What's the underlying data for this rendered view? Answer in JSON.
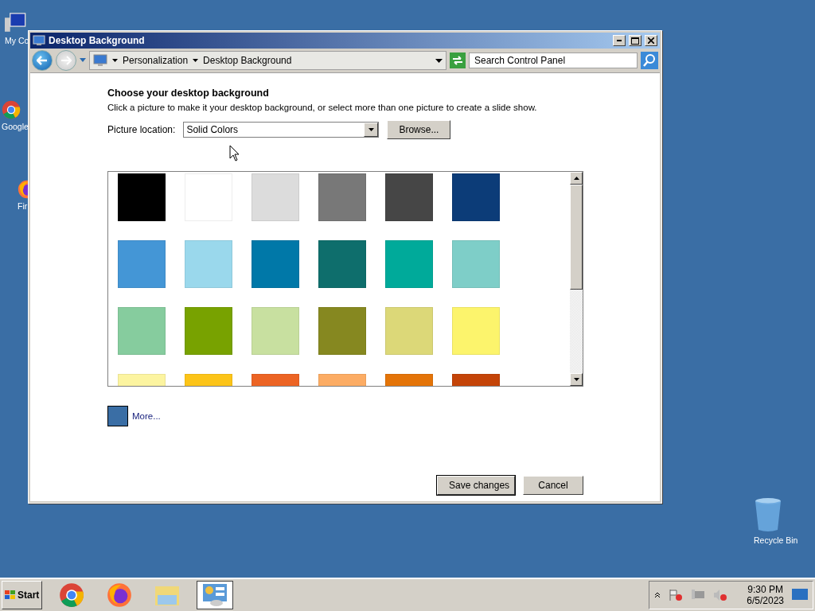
{
  "desktop_icons": [
    {
      "label": "My Co",
      "kind": "computer"
    },
    {
      "label": "Google",
      "kind": "chrome"
    },
    {
      "label": "Fir",
      "kind": "firefox"
    },
    {
      "label": "Recycle Bin",
      "kind": "bin"
    }
  ],
  "window": {
    "title": "Desktop Background",
    "breadcrumb": [
      "Personalization",
      "Desktop Background"
    ],
    "search": {
      "placeholder": "Search Control Panel"
    },
    "heading": "Choose your desktop background",
    "description": "Click a picture to make it your desktop background, or select more than one picture to create a slide show.",
    "location_label": "Picture location:",
    "location_value": "Solid Colors",
    "browse": "Browse...",
    "swatches": [
      {
        "color": "#000000"
      },
      {
        "color": "#ffffff"
      },
      {
        "color": "#dcdcdc"
      },
      {
        "color": "#787878"
      },
      {
        "color": "#464646"
      },
      {
        "color": "#0c3c78"
      },
      {
        "color": "#4496d6"
      },
      {
        "color": "#9ad8ec"
      },
      {
        "color": "#0078a8"
      },
      {
        "color": "#0e6e6c"
      },
      {
        "color": "#00aa9a"
      },
      {
        "color": "#7ecec8"
      },
      {
        "color": "#86cc9e"
      },
      {
        "color": "#78a200"
      },
      {
        "color": "#c8e0a0"
      },
      {
        "color": "#868820"
      },
      {
        "color": "#dcd878"
      },
      {
        "color": "#fcf46c"
      },
      {
        "color": "#fcf4a0"
      },
      {
        "color": "#fcc418"
      },
      {
        "color": "#ec6424"
      },
      {
        "color": "#fcac64"
      },
      {
        "color": "#e47408"
      },
      {
        "color": "#c44408"
      }
    ],
    "more": {
      "label": "More...",
      "color": "#3a6ea5"
    },
    "buttons": [
      "Save changes",
      "Cancel"
    ]
  },
  "taskbar": {
    "start": "Start",
    "apps": [
      {
        "kind": "chrome",
        "selected": false
      },
      {
        "kind": "firefox",
        "selected": false
      },
      {
        "kind": "explorer",
        "selected": false
      },
      {
        "kind": "control",
        "selected": true
      }
    ],
    "time": "9:30 PM",
    "date": "6/5/2023"
  }
}
